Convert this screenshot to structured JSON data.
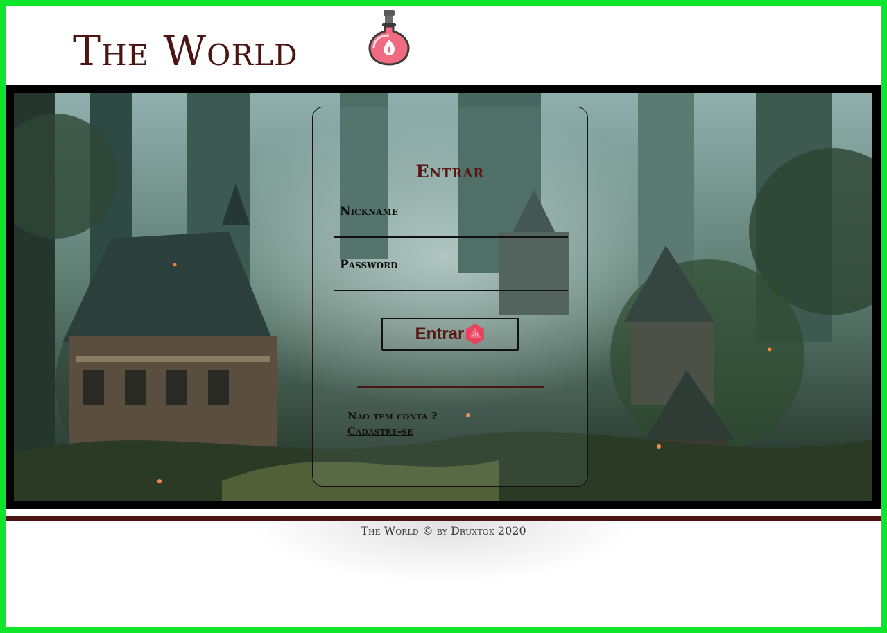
{
  "header": {
    "logo_text": "The World",
    "logo_icon": "potion-icon"
  },
  "login": {
    "title": "Entrar",
    "nickname_label": "Nickname",
    "password_label": "Password",
    "submit_label": "Entrar",
    "submit_icon": "d20-dice-icon",
    "d20_value": "20",
    "signup_question": "Não tem conta ?",
    "signup_link": "Cadastre-se"
  },
  "footer": {
    "text": "The World © by Druxtok 2020"
  },
  "colors": {
    "brand": "#4a1512",
    "accent_green_border": "#0fe52b",
    "d20_red": "#e8425c",
    "potion_pink": "#f06a82"
  }
}
